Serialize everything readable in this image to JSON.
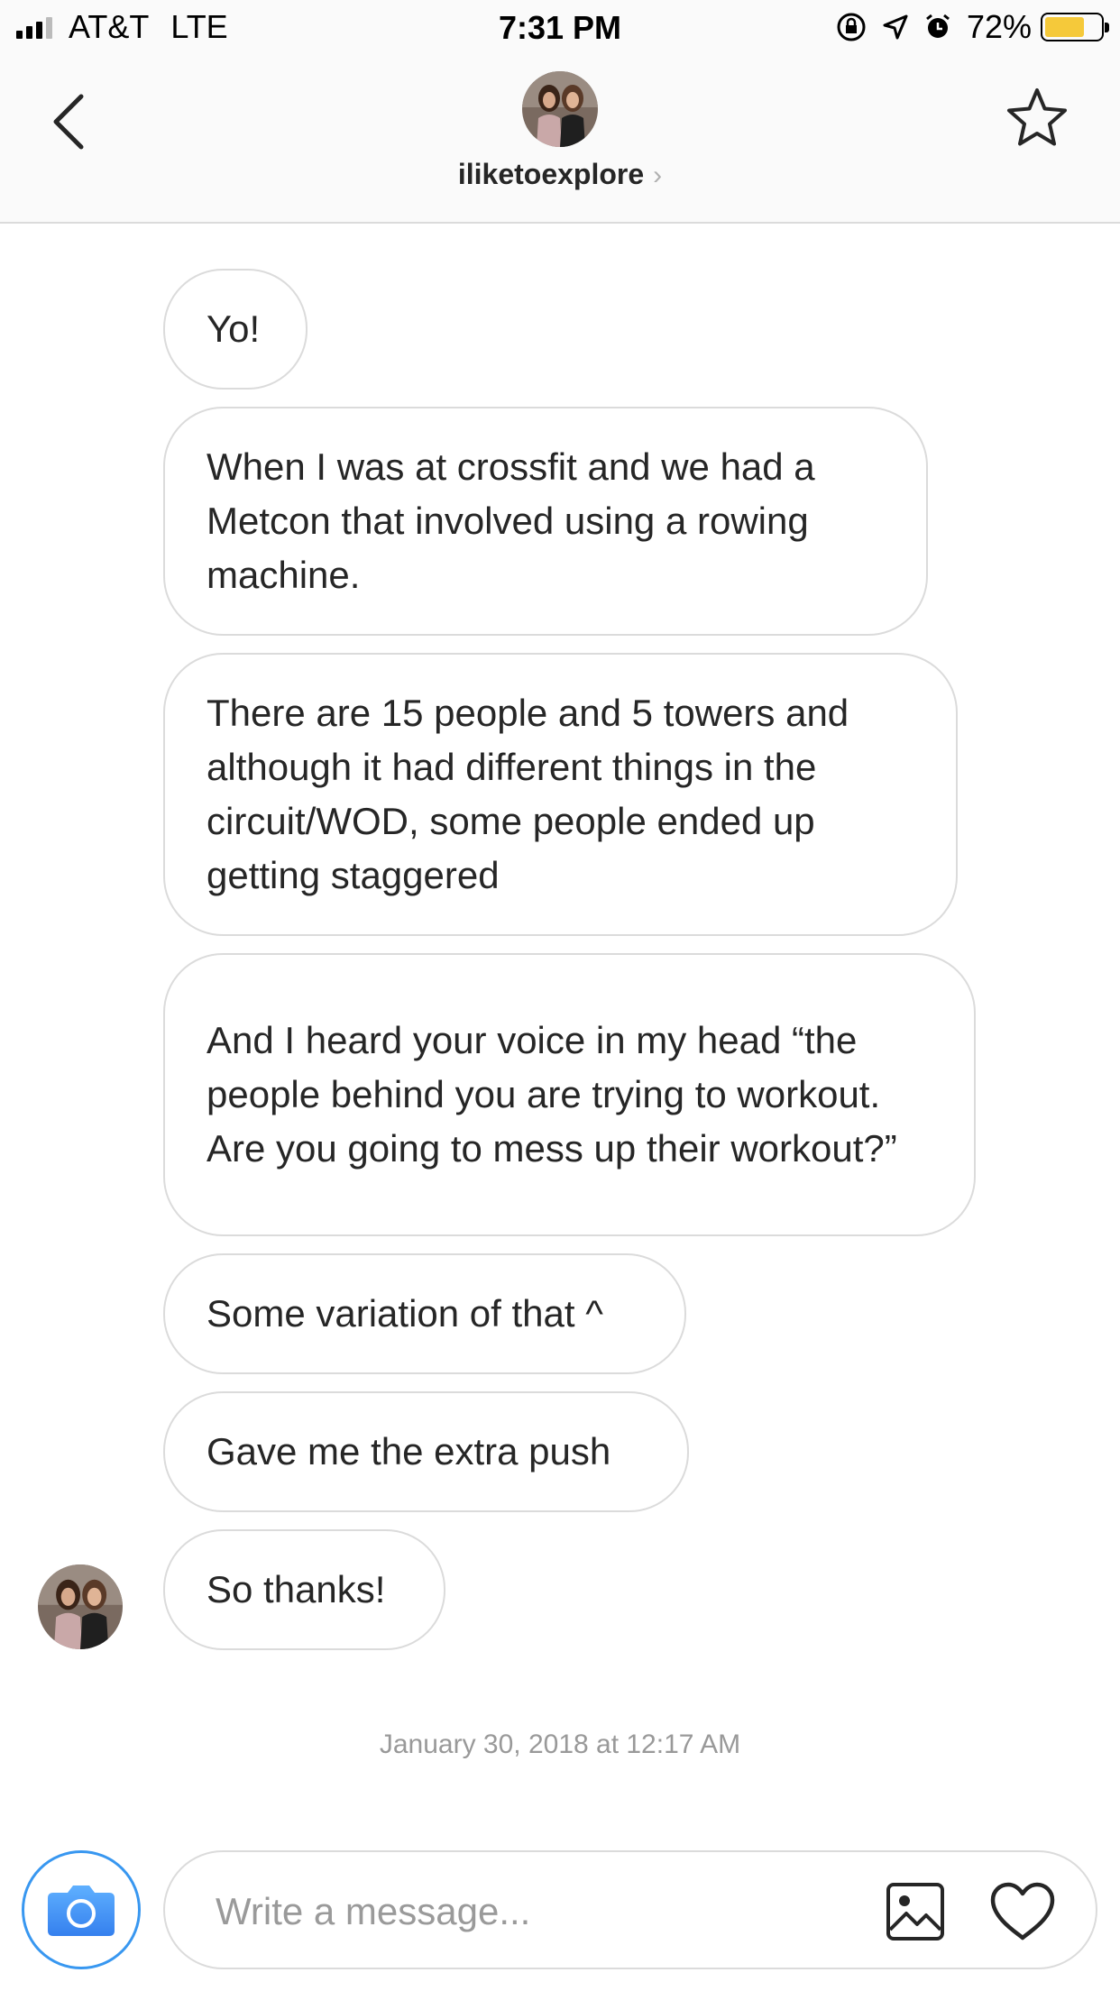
{
  "status_bar": {
    "carrier": "AT&T",
    "network": "LTE",
    "time": "7:31 PM",
    "battery": "72%",
    "battery_level": 0.72,
    "battery_color": "#f5c93a"
  },
  "header": {
    "username": "iliketoexplore",
    "chevron": "›",
    "back_icon": "chevron-left-icon",
    "star_icon": "star-icon"
  },
  "messages": [
    {
      "text": "Yo!"
    },
    {
      "text": "When I was at crossfit and we had a Metcon that involved using a rowing machine."
    },
    {
      "text": "There are 15 people and 5 towers and although it had different things in the circuit/WOD, some people ended up getting staggered"
    },
    {
      "text": "And I heard your voice in my head “the people behind you are trying to workout. Are you going to mess up their workout?”"
    },
    {
      "text": "Some variation of that ^"
    },
    {
      "text": "Gave me the extra push"
    },
    {
      "text": "So thanks!"
    }
  ],
  "timestamp": "January 30, 2018 at 12:17 AM",
  "composer": {
    "placeholder": "Write a message...",
    "camera_icon": "camera-icon",
    "gallery_icon": "gallery-icon",
    "heart_icon": "heart-icon",
    "accent_color": "#3897f0"
  }
}
